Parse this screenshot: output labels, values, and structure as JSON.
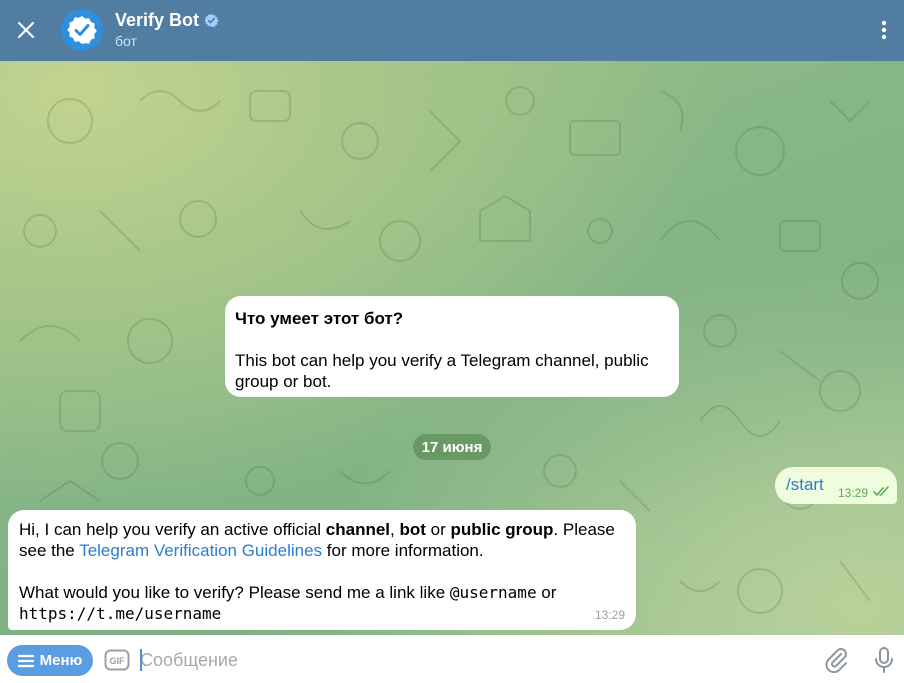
{
  "header": {
    "title": "Verify Bot",
    "subtitle": "бот",
    "bg_color": "#517da2"
  },
  "info_card": {
    "title": "Что умеет этот бот?",
    "body": "This bot can help you verify a Telegram channel, public group or bot."
  },
  "date_separator": "17 июня",
  "messages": [
    {
      "direction": "outgoing",
      "text": "/start",
      "time": "13:29",
      "status": "read"
    },
    {
      "direction": "incoming",
      "p1_a": "Hi, I can help you verify an active official ",
      "p1_channel": "channel",
      "p1_b": ", ",
      "p1_bot": "bot",
      "p1_c": " or ",
      "p1_group": "public group",
      "p1_d": ". Please see the ",
      "p1_link": "Telegram Verification Guidelines",
      "p1_e": " for more information.",
      "p2_a": "What would you like to verify? Please send me a link like ",
      "p2_code1": "@username",
      "p2_b": " or",
      "p2_code2": "https://t.me/username",
      "time": "13:29"
    }
  ],
  "composer": {
    "menu_label": "Меню",
    "gif_label": "GIF",
    "placeholder": "Сообщение"
  }
}
